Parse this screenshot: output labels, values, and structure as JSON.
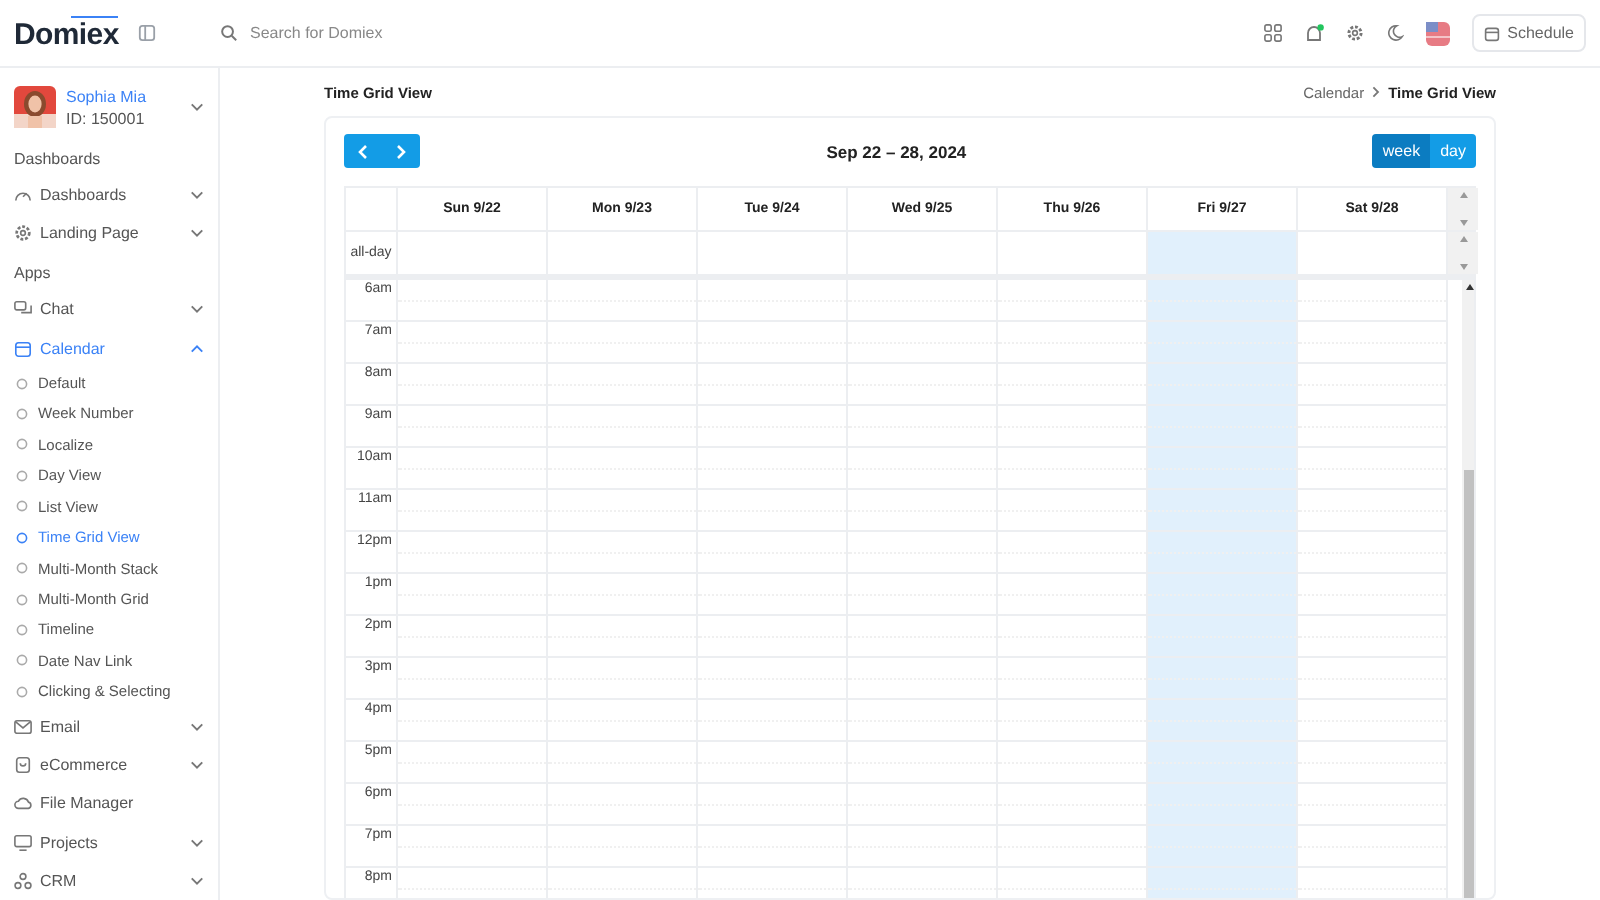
{
  "header": {
    "logo": "Domiex",
    "search": {
      "placeholder": "Search for Domiex"
    },
    "button": "Schedule"
  },
  "user": {
    "name": "Sophia Mia",
    "id": "ID: 150001"
  },
  "sidebar": {
    "items": [
      {
        "kind": "section",
        "label": "Dashboards"
      },
      {
        "kind": "menu",
        "label": "Dashboards",
        "selected": false,
        "expanded": false
      },
      {
        "kind": "menu",
        "label": "Landing Page",
        "selected": false,
        "expanded": false
      },
      {
        "kind": "section",
        "label": "Apps"
      },
      {
        "kind": "menu",
        "label": "Chat",
        "selected": false,
        "expanded": false
      },
      {
        "kind": "menu",
        "label": "Calendar",
        "selected": true,
        "expanded": true,
        "children": [
          {
            "label": "Default",
            "selected": false
          },
          {
            "label": "Week Number",
            "selected": false
          },
          {
            "label": "Localize",
            "selected": false
          },
          {
            "label": "Day View",
            "selected": false
          },
          {
            "label": "List View",
            "selected": false
          },
          {
            "label": "Time Grid View",
            "selected": true
          },
          {
            "label": "Multi-Month Stack",
            "selected": false
          },
          {
            "label": "Multi-Month Grid",
            "selected": false
          },
          {
            "label": "Timeline",
            "selected": false
          },
          {
            "label": "Date Nav Link",
            "selected": false
          },
          {
            "label": "Clicking & Selecting",
            "selected": false
          }
        ]
      },
      {
        "kind": "menu",
        "label": "Email",
        "selected": false,
        "expanded": false
      },
      {
        "kind": "menu",
        "label": "eCommerce",
        "selected": false,
        "expanded": false
      },
      {
        "kind": "link",
        "label": "File Manager",
        "selected": false
      },
      {
        "kind": "menu",
        "label": "Projects",
        "selected": false,
        "expanded": false
      },
      {
        "kind": "menu",
        "label": "CRM",
        "selected": false,
        "expanded": false
      }
    ]
  },
  "page": {
    "title": "Time Grid View",
    "breadcrumb": [
      "Calendar",
      "Time Grid View"
    ]
  },
  "calendar": {
    "title": "Sep 22 – 28, 2024",
    "views": [
      {
        "label": "week",
        "selected": true
      },
      {
        "label": "day",
        "selected": false
      }
    ],
    "days": [
      {
        "label": "Sun 9/22",
        "today": false
      },
      {
        "label": "Mon 9/23",
        "today": false
      },
      {
        "label": "Tue 9/24",
        "today": false
      },
      {
        "label": "Wed 9/25",
        "today": false
      },
      {
        "label": "Thu 9/26",
        "today": false
      },
      {
        "label": "Fri 9/27",
        "today": true
      },
      {
        "label": "Sat 9/28",
        "today": false
      }
    ],
    "all_day_label": "all-day",
    "times": [
      "6am",
      "7am",
      "8am",
      "9am",
      "10am",
      "11am",
      "12pm",
      "1pm",
      "2pm",
      "3pm",
      "4pm",
      "5pm",
      "6pm",
      "7pm",
      "8pm"
    ]
  }
}
